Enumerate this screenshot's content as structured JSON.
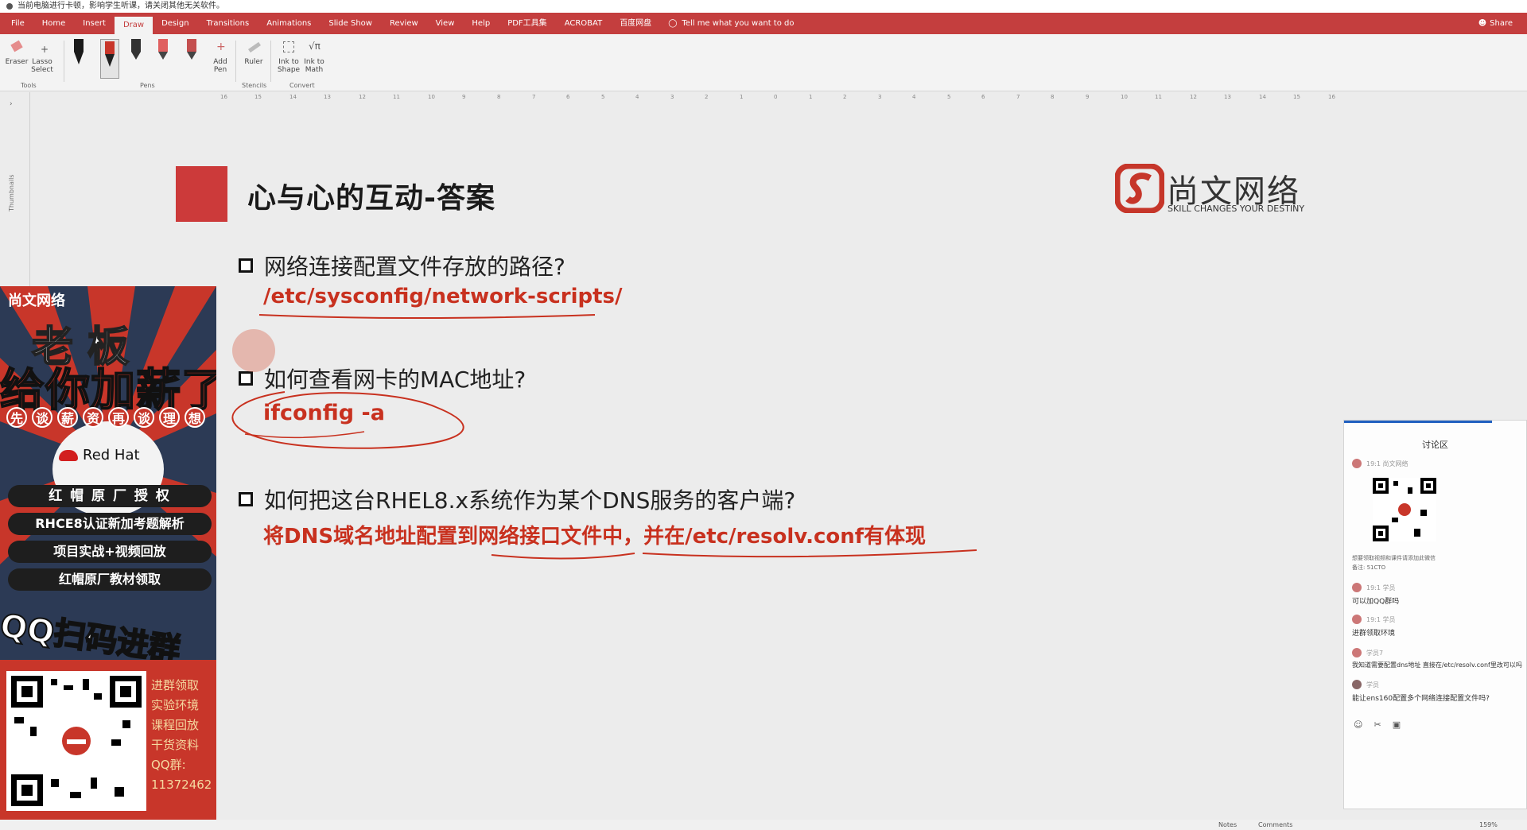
{
  "notice": {
    "text": "当前电脑进行卡顿，影响学生听课，请关闭其他无关软件。"
  },
  "ribbon_tabs": [
    "File",
    "Home",
    "Insert",
    "Draw",
    "Design",
    "Transitions",
    "Animations",
    "Slide Show",
    "Review",
    "View",
    "Help",
    "PDF工具集",
    "ACROBAT",
    "百度网盘"
  ],
  "active_tab": "Draw",
  "tell_me": "Tell me what you want to do",
  "share_label": "Share",
  "ribbon": {
    "eraser": "Eraser",
    "lasso": "Lasso Select",
    "tools_group": "Tools",
    "pens_group": "Pens",
    "add_pen": "Add Pen",
    "ruler": "Ruler",
    "stencils_group": "Stencils",
    "ink_to_shape": "Ink to Shape",
    "ink_to_math": "Ink to Math",
    "convert_group": "Convert",
    "pen_colors": [
      "#1a1a1a",
      "#c8362a",
      "#333333",
      "#e06060",
      "#c44f4f",
      "#d24f5f"
    ]
  },
  "ruler_ticks": [
    "16",
    "15",
    "14",
    "13",
    "12",
    "11",
    "10",
    "9",
    "8",
    "7",
    "6",
    "5",
    "4",
    "3",
    "2",
    "1",
    "0",
    "1",
    "2",
    "3",
    "4",
    "5",
    "6",
    "7",
    "8",
    "9",
    "10",
    "11",
    "12",
    "13",
    "14",
    "15",
    "16"
  ],
  "thumbnails_label": "Thumbnails",
  "slide": {
    "title": "心与心的互动-答案",
    "logo_name": "尚文网络",
    "logo_tagline": "SKILL CHANGES YOUR DESTINY",
    "q1": "网络连接配置文件存放的路径?",
    "a1": "/etc/sysconfig/network-scripts/",
    "q2": "如何查看网卡的MAC地址?",
    "a2": "ifconfig -a",
    "q3": "如何把这台RHEL8.x系统作为某个DNS服务的客户端?",
    "a3": "将DNS域名地址配置到网络接口文件中，并在/etc/resolv.conf有体现"
  },
  "ad": {
    "brand": "尚文网络",
    "line1": "老板",
    "line2": "给你加薪了",
    "circles": [
      "先",
      "谈",
      "薪",
      "资",
      "再",
      "谈",
      "理",
      "想"
    ],
    "redhat": "Red Hat",
    "bars": [
      "红 帽 原 厂 授 权",
      "RHCE8认证新加考题解析",
      "项目实战+视频回放",
      "红帽原厂教材领取"
    ],
    "qq": "QQ扫码进群",
    "side_lines": [
      "进群领取",
      "实验环境",
      "课程回放",
      "干货资料",
      "QQ群:",
      "11372462"
    ]
  },
  "discussion": {
    "title": "讨论区",
    "messages": [
      {
        "meta": "19:1 尚文网络",
        "text": ""
      },
      {
        "meta": "",
        "text": "想要领取视频和课件请添加此微信"
      },
      {
        "meta": "",
        "text": "备注: 51CTO"
      },
      {
        "meta": "19:1 学员",
        "text": "可以加QQ群吗"
      },
      {
        "meta": "19:1 学员",
        "text": "进群领取环境"
      },
      {
        "meta": "学员7",
        "text": "我知道需要配置dns地址 直接在/etc/resolv.conf里改可以吗"
      },
      {
        "meta": "学员",
        "text": "能让ens160配置多个网络连接配置文件吗?"
      }
    ],
    "icons": [
      "smile-icon",
      "scissors-icon",
      "image-icon"
    ]
  },
  "status_bar": {
    "notes": "Notes",
    "comments": "Comments",
    "zoom": "159%"
  }
}
